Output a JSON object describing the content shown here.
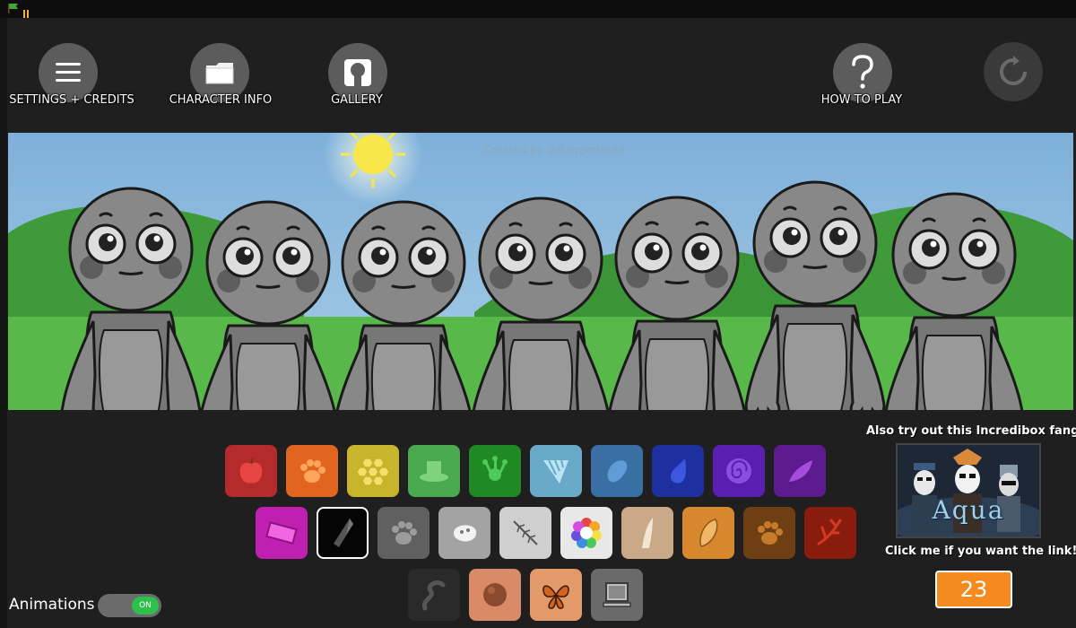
{
  "header": {
    "buttons": [
      {
        "label": "SETTINGS + CREDITS",
        "icon": "menu-icon"
      },
      {
        "label": "CHARACTER INFO",
        "icon": "folder-icon"
      },
      {
        "label": "GALLERY",
        "icon": "gallery-icon"
      },
      {
        "label": "HOW TO PLAY",
        "icon": "question-icon"
      },
      {
        "label": "",
        "icon": "reset-icon"
      }
    ]
  },
  "scene": {
    "credit": "Created by @BaggerHead",
    "characters": 7
  },
  "palette": {
    "row1": [
      "red",
      "orange",
      "yellow",
      "light-green",
      "green",
      "light-blue",
      "blue",
      "dark-blue",
      "violet",
      "purple"
    ],
    "row2": [
      "magenta",
      "black",
      "gray",
      "white",
      "light-gray",
      "multicolor",
      "tan",
      "light-brown",
      "brown",
      "dark-red"
    ],
    "row3": [
      "dark-gray",
      "salmon",
      "peach",
      "silver"
    ],
    "selected": "black"
  },
  "promo": {
    "title": "Also try out this Incredibox fangame!",
    "image_text": "Aqua",
    "subtitle": "Click me if you want the link!"
  },
  "counter": {
    "value": "23"
  },
  "animations": {
    "label": "Animations",
    "toggle": "ON"
  }
}
